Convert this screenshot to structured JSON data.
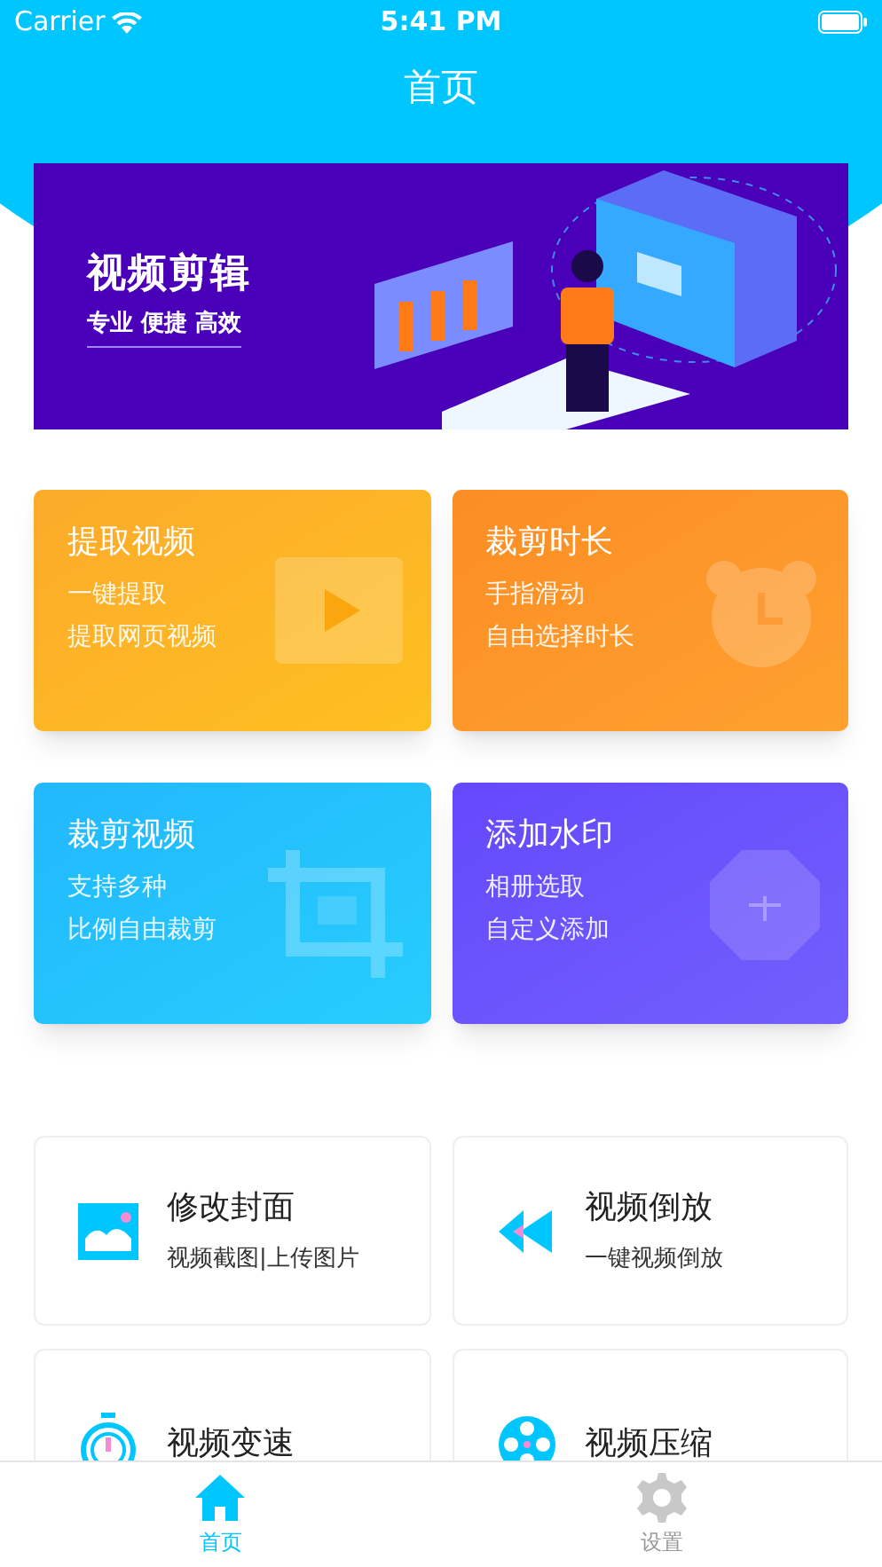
{
  "status_bar": {
    "carrier": "Carrier",
    "time": "5:41 PM"
  },
  "nav_title": "首页",
  "banner": {
    "title": "视频剪辑",
    "subtitle": "专业 便捷 高效"
  },
  "feature_cards": [
    {
      "title": "提取视频",
      "lines": [
        "一键提取",
        "提取网页视频"
      ]
    },
    {
      "title": "裁剪时长",
      "lines": [
        "手指滑动",
        "自由选择时长"
      ]
    },
    {
      "title": "裁剪视频",
      "lines": [
        "支持多种",
        "比例自由裁剪"
      ]
    },
    {
      "title": "添加水印",
      "lines": [
        "相册选取",
        "自定义添加"
      ]
    }
  ],
  "tool_cards": [
    {
      "title": "修改封面",
      "subtitle": "视频截图|上传图片"
    },
    {
      "title": "视频倒放",
      "subtitle": "一键视频倒放"
    },
    {
      "title": "视频变速"
    },
    {
      "title": "视频压缩"
    }
  ],
  "tab_bar": [
    {
      "label": "首页",
      "selected": true
    },
    {
      "label": "设置",
      "selected": false
    }
  ]
}
